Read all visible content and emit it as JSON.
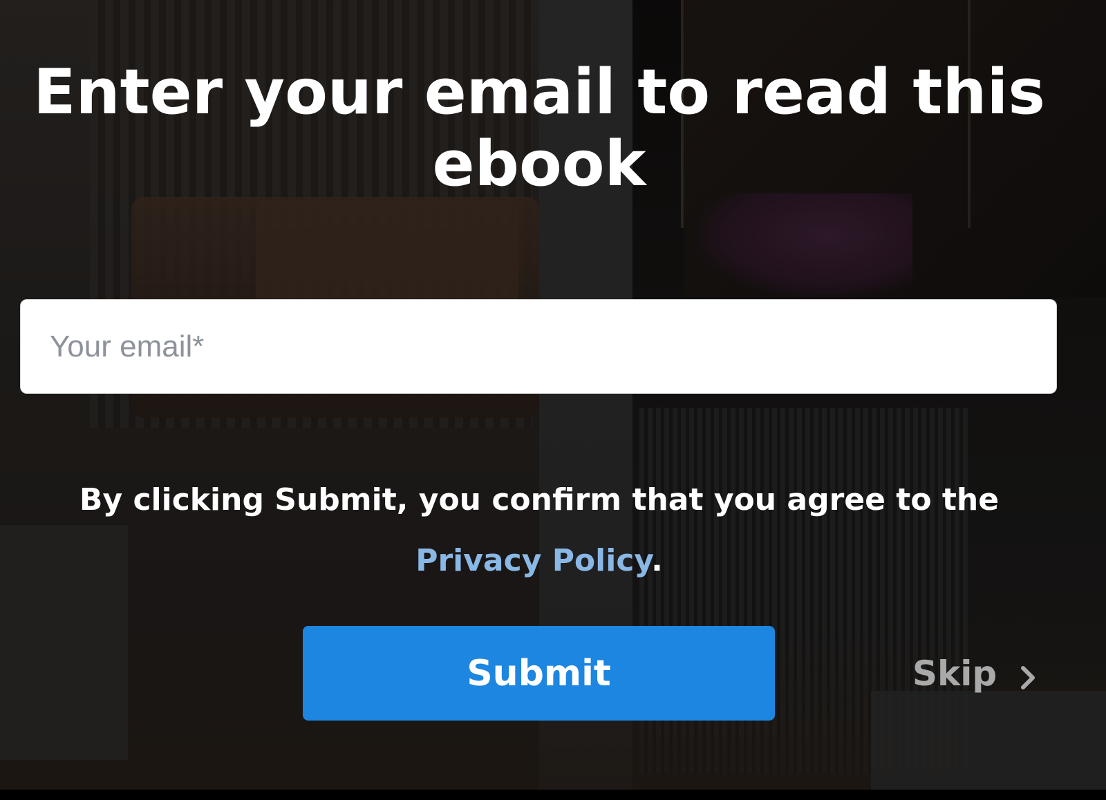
{
  "dialog": {
    "headline": "Enter your email to read this ebook",
    "email_placeholder": "Your email*",
    "consent_text": "By clicking Submit, you confirm that you agree to the ",
    "consent_link": "Privacy Policy",
    "consent_end": ".",
    "submit_label": "Submit",
    "skip_label": "Skip",
    "skip_icon": "chevron-right-icon"
  },
  "colors": {
    "submit_button": "#1d86e0",
    "link": "#8ab8e6",
    "skip_text": "#a9a9a9"
  }
}
